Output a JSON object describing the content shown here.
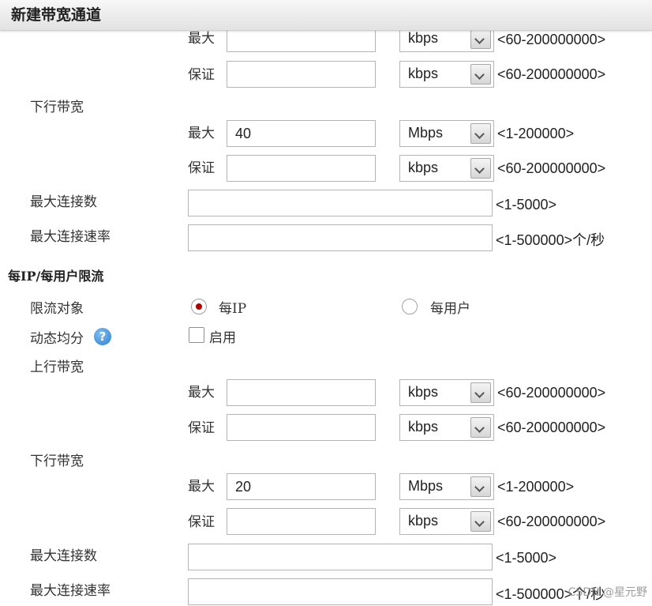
{
  "header": {
    "title": "新建带宽通道"
  },
  "section1": {
    "upload": {
      "max_label": "最大",
      "max_value": "",
      "max_unit": "kbps",
      "max_range": "<60-200000000>",
      "guarantee_label": "保证",
      "guarantee_value": "",
      "guarantee_unit": "kbps",
      "guarantee_range": "<60-200000000>"
    },
    "download": {
      "label": "下行带宽",
      "max_label": "最大",
      "max_value": "40",
      "max_unit": "Mbps",
      "max_range": "<1-200000>",
      "guarantee_label": "保证",
      "guarantee_value": "",
      "guarantee_unit": "kbps",
      "guarantee_range": "<60-200000000>"
    },
    "max_connections": {
      "label": "最大连接数",
      "value": "",
      "range": "<1-5000>"
    },
    "max_conn_rate": {
      "label": "最大连接速率",
      "value": "",
      "range": "<1-500000>个/秒"
    }
  },
  "per_ip": {
    "title": "每IP/每用户限流",
    "target": {
      "label": "限流对象",
      "option_ip": "每IP",
      "option_user": "每用户",
      "selected": "每IP"
    },
    "dynamic": {
      "label": "动态均分",
      "help_icon": "?",
      "checkbox_label": "启用",
      "checked": false
    },
    "upload": {
      "label": "上行带宽",
      "max_label": "最大",
      "max_value": "",
      "max_unit": "kbps",
      "max_range": "<60-200000000>",
      "guarantee_label": "保证",
      "guarantee_value": "",
      "guarantee_unit": "kbps",
      "guarantee_range": "<60-200000000>"
    },
    "download": {
      "label": "下行带宽",
      "max_label": "最大",
      "max_value": "20",
      "max_unit": "Mbps",
      "max_range": "<1-200000>",
      "guarantee_label": "保证",
      "guarantee_value": "",
      "guarantee_unit": "kbps",
      "guarantee_range": "<60-200000000>"
    },
    "max_connections": {
      "label": "最大连接数",
      "value": "",
      "range": "<1-5000>"
    },
    "max_conn_rate": {
      "label": "最大连接速率",
      "value": "",
      "range": "<1-500000>个/秒"
    }
  },
  "watermark": "CSDN @星元野",
  "colors": {
    "radio_selected": "#b00000",
    "help_icon": "#2a7fd0"
  }
}
